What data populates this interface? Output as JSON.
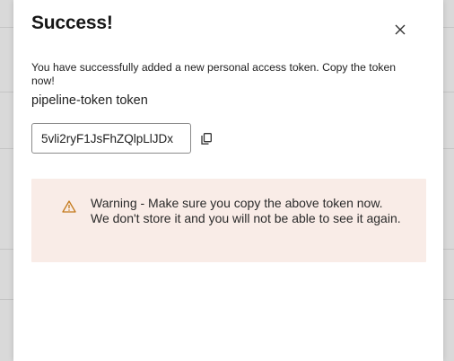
{
  "modal": {
    "title": "Success!",
    "description": "You have successfully added a new personal access token. Copy the token now!",
    "token_name": "pipeline-token token",
    "token_value": "5vli2ryF1JsFhZQlpLlJDx",
    "warning": "Warning - Make sure you copy the above token now. We don't store it and you will not be able to see it again."
  },
  "icons": {
    "close": "close-icon",
    "copy": "copy-icon",
    "warning": "warning-triangle-icon"
  },
  "colors": {
    "warning_background": "#f9ece7",
    "warning_icon": "#c47a1c"
  }
}
